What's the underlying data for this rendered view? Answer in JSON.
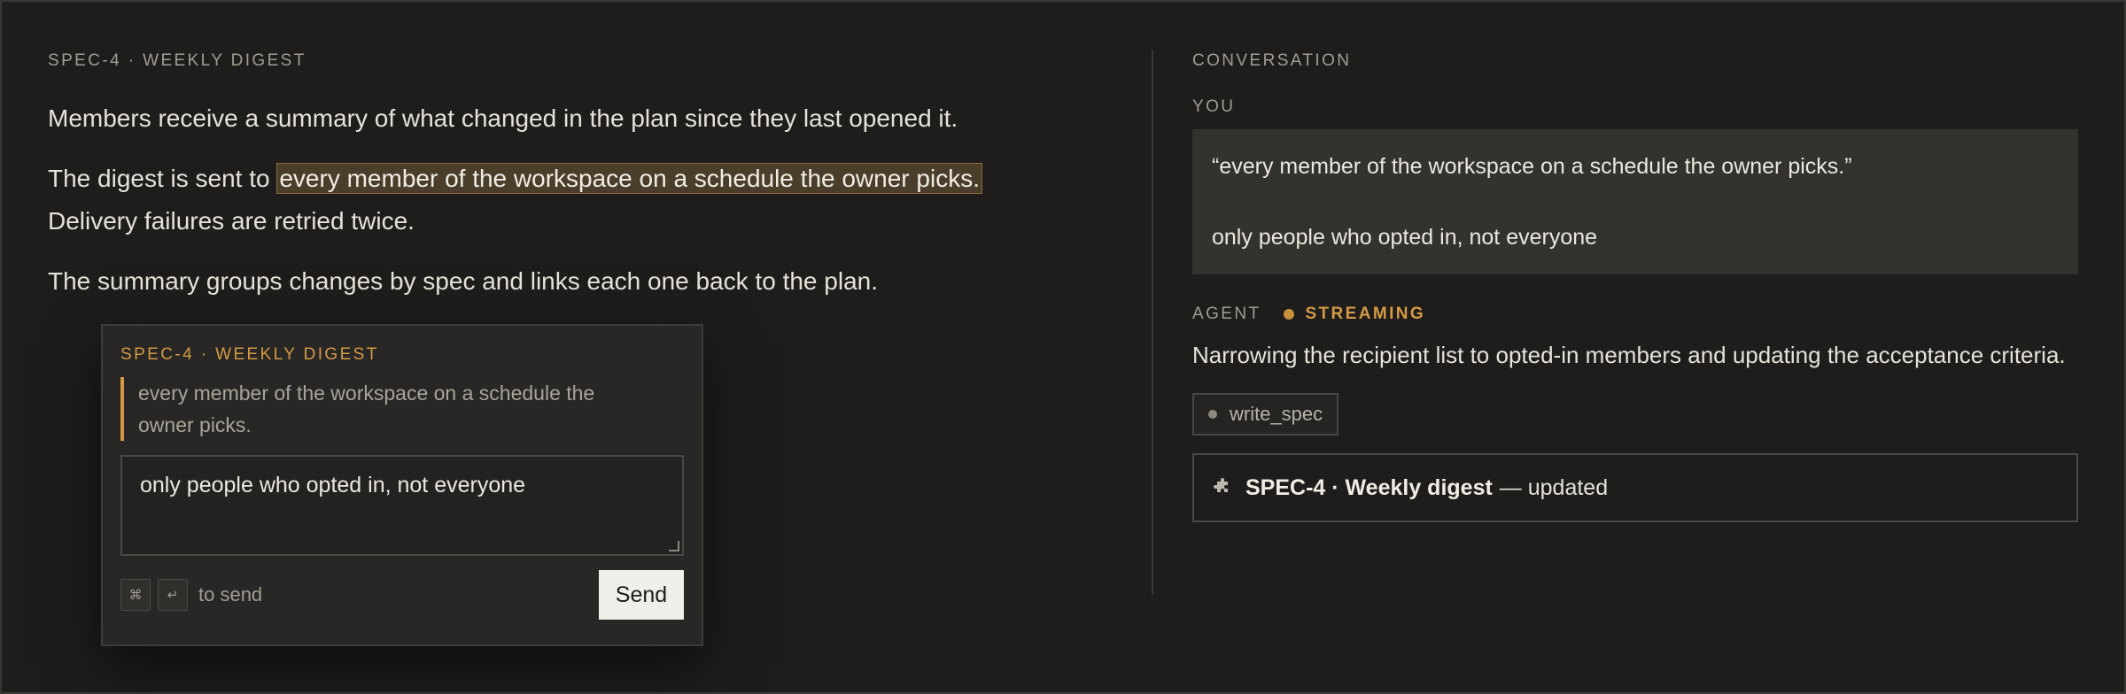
{
  "doc": {
    "eyebrow": "SPEC-4 · WEEKLY DIGEST",
    "para1": "Members receive a summary of what changed in the plan since they last opened it.",
    "para2_before": "The digest is sent to ",
    "para2_highlight": "every member of the workspace on a schedule the owner picks.",
    "para2_after": "Delivery failures are retried twice.",
    "para3": "The summary groups changes by spec and links each one back to the plan."
  },
  "popup": {
    "eyebrow": "SPEC-4 · WEEKLY DIGEST",
    "quote": "every member of the workspace on a schedule the owner picks.",
    "reply": "only people who opted in, not everyone",
    "kbd_cmd": "⌘",
    "kbd_enter": "↵",
    "hint": "to send",
    "send_label": "Send"
  },
  "conversation": {
    "eyebrow": "CONVERSATION",
    "you_label": "YOU",
    "you_quote": "“every member of the workspace on a schedule the owner picks.”",
    "you_message": "only people who opted in, not everyone",
    "agent_label": "AGENT",
    "status": "STREAMING",
    "agent_message": "Narrowing the recipient list to opted-in members and updating the acceptance criteria.",
    "tool_name": "write_spec",
    "result_title": "SPEC-4 · Weekly digest",
    "result_suffix": "— updated",
    "result_icon": "puzzle-icon"
  },
  "colors": {
    "background": "#1e1d1b",
    "accent": "#d49a45",
    "highlight_bg": "#4a3e2b"
  }
}
